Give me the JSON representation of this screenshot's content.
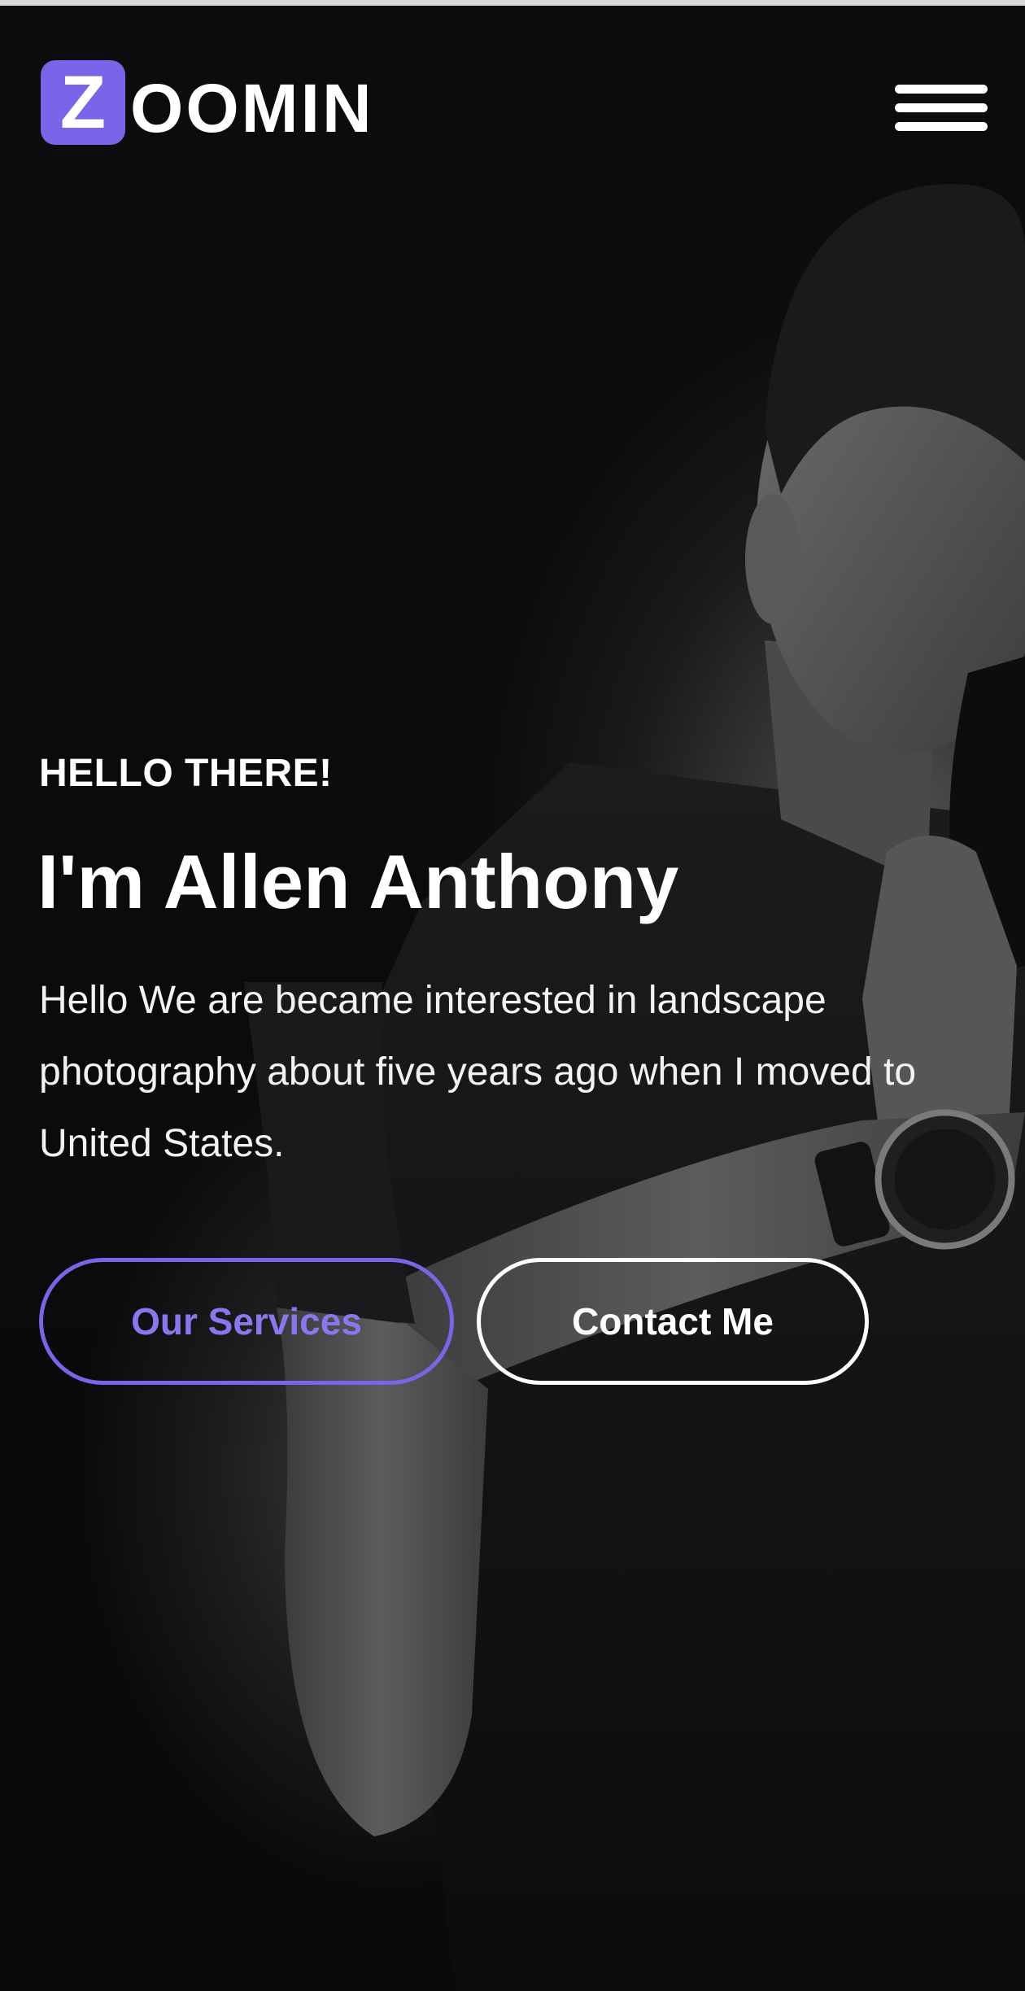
{
  "header": {
    "logo_initial": "Z",
    "logo_rest": "OOMIN",
    "menu_icon": "hamburger-menu-icon"
  },
  "hero": {
    "greeting": "HELLO THERE!",
    "headline": "I'm Allen Anthony",
    "intro": "Hello We are became interested in landscape photography about five years ago when I moved to United States.",
    "primary_button_label": "Our Services",
    "secondary_button_label": "Contact Me",
    "background_image": "monochrome portrait of a photographer holding a camera"
  },
  "colors": {
    "accent": "#7b64e8",
    "background": "#0a0a0c",
    "text": "#ffffff"
  }
}
